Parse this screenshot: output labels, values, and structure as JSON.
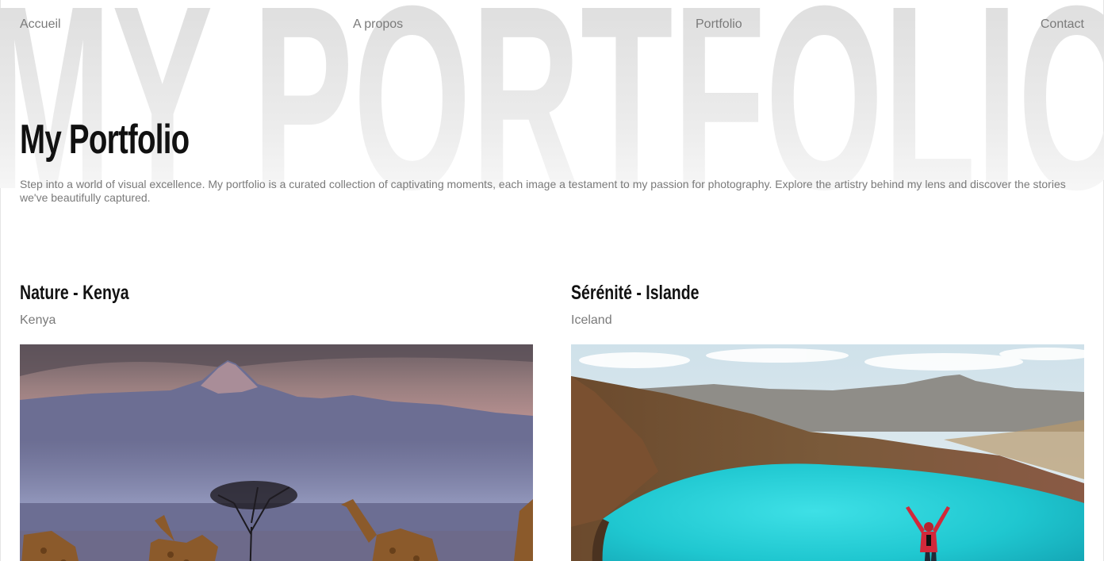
{
  "watermark": {
    "text": "MY PORTFOLIO"
  },
  "nav": {
    "items": [
      {
        "label": "Accueil"
      },
      {
        "label": "A propos"
      },
      {
        "label": "Portfolio"
      },
      {
        "label": "Contact"
      }
    ]
  },
  "hero": {
    "title": "My Portfolio",
    "description": "Step into a world of visual excellence. My portfolio is a curated collection of captivating moments, each image a testament to my passion for photography. Explore the artistry behind my lens and discover the stories we've beautifully captured."
  },
  "projects": [
    {
      "title": "Nature - Kenya",
      "location": "Kenya",
      "image": "giraffes-mountain-photo"
    },
    {
      "title": "Sérénité - Islande",
      "location": "Iceland",
      "image": "crater-lake-hiker-photo"
    }
  ],
  "colors": {
    "text": "#111111",
    "muted": "#7a7a7a",
    "background": "#ffffff",
    "watermark": "#e0e0e0"
  }
}
